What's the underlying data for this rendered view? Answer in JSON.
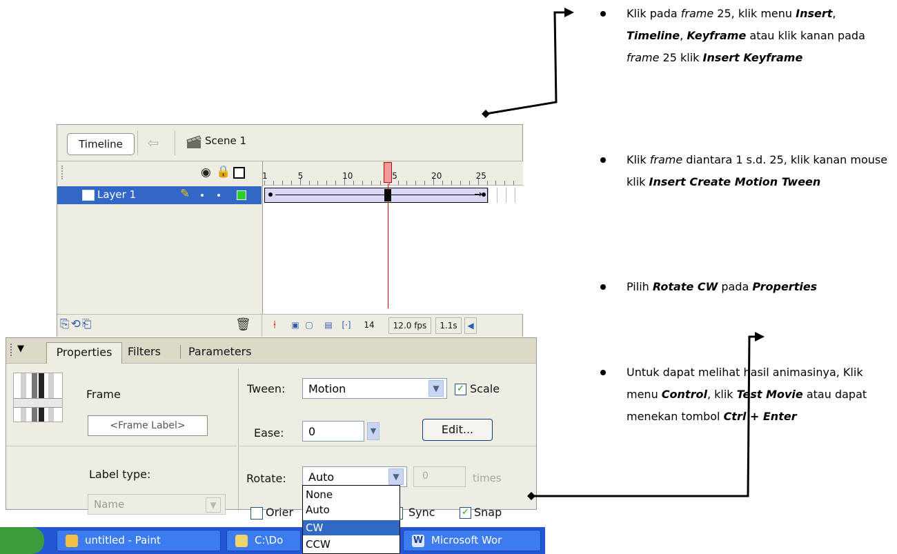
{
  "timeline": {
    "tab_label": "Timeline",
    "scene_label": "Scene 1",
    "layer_name": "Layer 1",
    "ruler_labels": [
      "1",
      "5",
      "10",
      "15",
      "20",
      "25"
    ],
    "current_frame": "14",
    "fps": "12.0 fps",
    "elapsed": "1.1s"
  },
  "properties_panel": {
    "tabs": [
      "Properties",
      "Filters",
      "Parameters"
    ],
    "frame_title": "Frame",
    "frame_label_placeholder": "<Frame Label>",
    "label_type_label": "Label type:",
    "label_type_value": "Name",
    "tween_label": "Tween:",
    "tween_value": "Motion",
    "scale_label": "Scale",
    "ease_label": "Ease:",
    "ease_value": "0",
    "edit_button": "Edit...",
    "rotate_label": "Rotate:",
    "rotate_value": "Auto",
    "times_value": "0",
    "times_label": "times",
    "orient_label": "Orier",
    "sync_label": "Sync",
    "snap_label": "Snap",
    "rotate_options": [
      "None",
      "Auto",
      "CW",
      "CCW"
    ],
    "rotate_selected": "CW"
  },
  "taskbar": {
    "items": [
      "untitled - Paint",
      "C:\\Do",
      "Microsoft Wor"
    ]
  },
  "instructions": [
    {
      "segments": [
        {
          "t": "Klik pada ",
          "s": "n"
        },
        {
          "t": "frame",
          "s": "i"
        },
        {
          "t": " 25, klik menu ",
          "s": "n"
        },
        {
          "t": "Insert",
          "s": "b"
        },
        {
          "t": ", ",
          "s": "n"
        },
        {
          "t": "Timeline",
          "s": "b"
        },
        {
          "t": ", ",
          "s": "n"
        },
        {
          "t": "Keyframe",
          "s": "b"
        },
        {
          "t": " atau klik kanan pada ",
          "s": "n"
        },
        {
          "t": "frame",
          "s": "i"
        },
        {
          "t": " 25 klik ",
          "s": "n"
        },
        {
          "t": "Insert Keyframe",
          "s": "b"
        }
      ]
    },
    {
      "segments": [
        {
          "t": "Klik ",
          "s": "n"
        },
        {
          "t": "frame",
          "s": "i"
        },
        {
          "t": " diantara 1 s.d. 25, klik kanan mouse klik ",
          "s": "n"
        },
        {
          "t": "Insert Create Motion Tween",
          "s": "b"
        }
      ]
    },
    {
      "segments": [
        {
          "t": "Pilih ",
          "s": "n"
        },
        {
          "t": "Rotate CW",
          "s": "b"
        },
        {
          "t": " pada ",
          "s": "n"
        },
        {
          "t": "Properties",
          "s": "b"
        }
      ]
    },
    {
      "segments": [
        {
          "t": "Untuk dapat melihat hasil animasinya, Klik menu ",
          "s": "n"
        },
        {
          "t": "Control",
          "s": "b"
        },
        {
          "t": ", klik ",
          "s": "n"
        },
        {
          "t": "Test Movie",
          "s": "b"
        },
        {
          "t": " atau dapat menekan tombol ",
          "s": "n"
        },
        {
          "t": "Ctrl + Enter",
          "s": "b"
        }
      ]
    }
  ]
}
